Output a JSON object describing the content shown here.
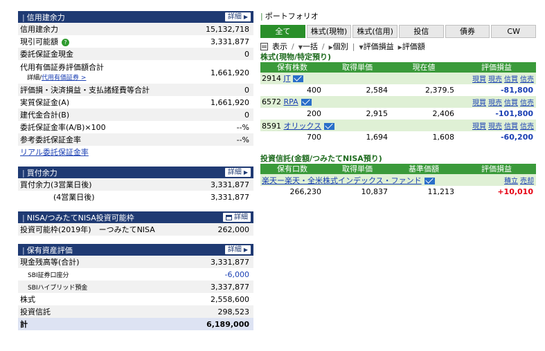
{
  "credit": {
    "title": "信用建余力",
    "detail": "詳細",
    "rows": [
      {
        "label": "信用建余力",
        "value": "15,132,718"
      },
      {
        "label": "現引可能額",
        "value": "3,331,877"
      },
      {
        "label": "委託保証金現金",
        "value": "0"
      },
      {
        "label": "代用有価証券評価額合計",
        "sublabel": "詳細/",
        "sublink": "代用有価証券 >",
        "value": "1,661,920"
      },
      {
        "label": "評価損・決済損益・支払諸経費等合計",
        "value": "0"
      },
      {
        "label": "実質保証金(A)",
        "value": "1,661,920"
      },
      {
        "label": "建代金合計(B)",
        "value": "0"
      },
      {
        "label": "委託保証金率(A/B)×100",
        "value": "--%"
      },
      {
        "label": "参考委託保証金率",
        "value": "--%"
      }
    ],
    "link": "リアル委託保証金率"
  },
  "buy": {
    "title": "買付余力",
    "detail": "詳細",
    "rows": [
      {
        "label": "買付余力(3営業日後)",
        "value": "3,331,877"
      },
      {
        "label": "(4営業日後)",
        "value": "3,331,877"
      }
    ]
  },
  "nisa": {
    "title": "NISA/つみたてNISA投資可能枠",
    "detail": "詳細",
    "rows": [
      {
        "label": "投資可能枠(2019年)　ーつみたてNISA",
        "value": "262,000"
      }
    ]
  },
  "assets": {
    "title": "保有資産評価",
    "detail": "詳細",
    "rows": [
      {
        "label": "現金残高等(合計)",
        "value": "3,331,877"
      },
      {
        "label": "SBI証券口座分",
        "value": "-6,000"
      },
      {
        "label": "SBIハイブリッド預金",
        "value": "3,337,877"
      },
      {
        "label": "株式",
        "value": "2,558,600"
      },
      {
        "label": "投資信託",
        "value": "298,523"
      },
      {
        "label": "計",
        "value": "6,189,000"
      }
    ]
  },
  "portfolio": {
    "title": "ポートフォリオ",
    "tabs": [
      "全て",
      "株式(現物)",
      "株式(信用)",
      "投信",
      "債券",
      "CW"
    ],
    "view": {
      "display": "表示",
      "all": "一括",
      "each": "個別",
      "pnl": "評価損益",
      "val": "評価額"
    },
    "stocks_title": "株式(現物/特定預り)",
    "stock_headers": [
      "保有株数",
      "取得単価",
      "現在値",
      "評価損益"
    ],
    "actions": [
      "現買",
      "現売",
      "信買",
      "信売"
    ],
    "stocks": [
      {
        "code": "2914",
        "name": "JT",
        "qty": "400",
        "cost": "2,584",
        "price": "2,379.5",
        "pnl": "-81,800"
      },
      {
        "code": "6572",
        "name": "RPA",
        "qty": "200",
        "cost": "2,915",
        "price": "2,406",
        "pnl": "-101,800"
      },
      {
        "code": "8591",
        "name": "オリックス",
        "qty": "700",
        "cost": "1,694",
        "price": "1,608",
        "pnl": "-60,200"
      }
    ],
    "funds_title": "投資信託(金額/つみたてNISA預り)",
    "fund_headers": [
      "保有口数",
      "取得単価",
      "基準価額",
      "評価損益"
    ],
    "fund_actions": [
      "積立",
      "売却"
    ],
    "funds": [
      {
        "name": "楽天ー楽天・全米株式インデックス・ファンド",
        "units": "266,230",
        "cost": "10,837",
        "nav": "11,213",
        "pnl": "+10,010"
      }
    ]
  },
  "colors": {
    "navy": "#1f3a73",
    "green": "#3a9a3a",
    "negative": "#1a3fb3",
    "positive": "#e60012"
  }
}
